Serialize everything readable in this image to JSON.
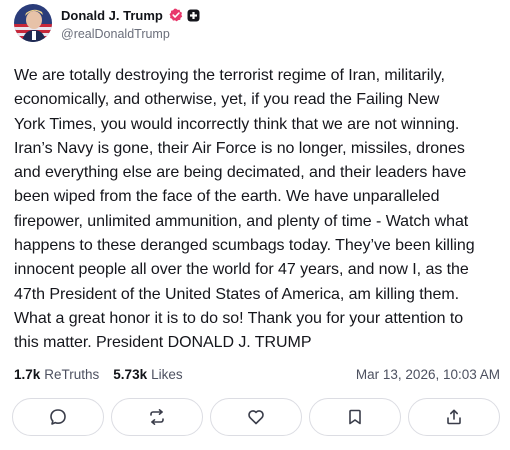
{
  "author": {
    "name": "Donald J. Trump",
    "handle": "@realDonaldTrump",
    "verified_icon": "verified-badge-icon",
    "badge_color": "#e8376b"
  },
  "post": {
    "text": "We are totally destroying the terrorist regime of Iran, militarily,\neconomically, and otherwise, yet, if you read the Failing New\nYork Times, you would incorrectly think that we are not winning.\nIran’s Navy is gone, their Air Force is no longer, missiles, drones\nand everything else are being decimated, and their leaders have\nbeen wiped from the face of the earth. We have unparalleled\nfirepower, unlimited ammunition, and plenty of time - Watch what\nhappens to these deranged scumbags today. They’ve been killing\ninnocent people all over the world for 47 years, and now I, as the\n47th President of the United States of America, am killing them.\nWhat a great honor it is to do so! Thank you for your attention to\nthis matter. President DONALD J. TRUMP"
  },
  "stats": {
    "retruths_count": "1.7k",
    "retruths_label": "ReTruths",
    "likes_count": "5.73k",
    "likes_label": "Likes",
    "timestamp": "Mar 13, 2026, 10:03 AM"
  },
  "actions": [
    {
      "icon": "comment-icon"
    },
    {
      "icon": "retruth-icon"
    },
    {
      "icon": "heart-icon"
    },
    {
      "icon": "bookmark-icon"
    },
    {
      "icon": "share-icon"
    }
  ]
}
